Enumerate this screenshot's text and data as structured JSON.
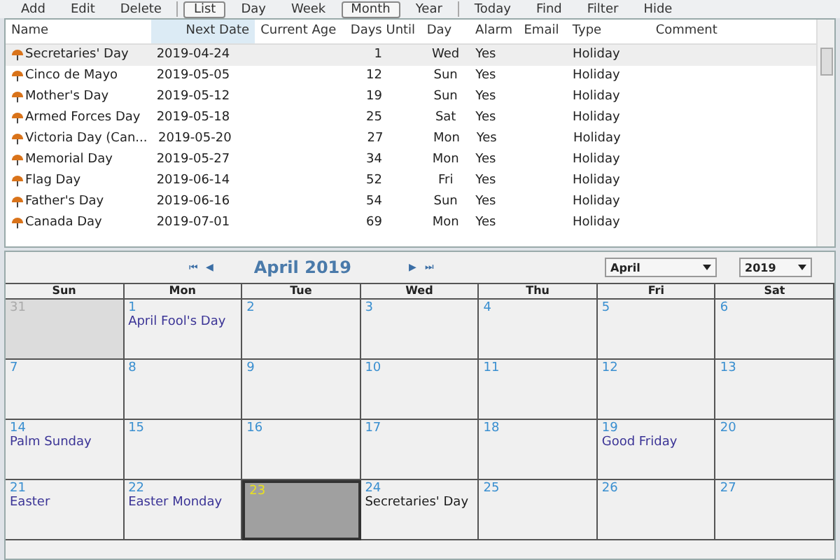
{
  "toolbar": [
    {
      "label": "Add",
      "selected": false
    },
    {
      "label": "Edit",
      "selected": false
    },
    {
      "label": "Delete",
      "selected": false,
      "divider_after": true
    },
    {
      "label": "List",
      "selected": true
    },
    {
      "label": "Day",
      "selected": false
    },
    {
      "label": "Week",
      "selected": false
    },
    {
      "label": "Month",
      "selected": true
    },
    {
      "label": "Year",
      "selected": false,
      "divider_after": true
    },
    {
      "label": "Today",
      "selected": false
    },
    {
      "label": "Find",
      "selected": false
    },
    {
      "label": "Filter",
      "selected": false
    },
    {
      "label": "Hide",
      "selected": false
    }
  ],
  "table": {
    "columns": [
      {
        "label": "Name",
        "sorted": false
      },
      {
        "label": "Next Date",
        "sorted": true
      },
      {
        "label": "Current Age",
        "sorted": false
      },
      {
        "label": "Days Until",
        "sorted": false
      },
      {
        "label": "Day",
        "sorted": false
      },
      {
        "label": "Alarm",
        "sorted": false
      },
      {
        "label": "Email",
        "sorted": false
      },
      {
        "label": "Type",
        "sorted": false
      },
      {
        "label": "Comment",
        "sorted": false
      }
    ],
    "rows": [
      {
        "selected": true,
        "cells": [
          "Secretaries' Day",
          "2019-04-24",
          "",
          "1",
          "Wed",
          "Yes",
          "",
          "Holiday",
          ""
        ]
      },
      {
        "selected": false,
        "cells": [
          "Cinco de Mayo",
          "2019-05-05",
          "",
          "12",
          "Sun",
          "Yes",
          "",
          "Holiday",
          ""
        ]
      },
      {
        "selected": false,
        "cells": [
          "Mother's Day",
          "2019-05-12",
          "",
          "19",
          "Sun",
          "Yes",
          "",
          "Holiday",
          ""
        ]
      },
      {
        "selected": false,
        "cells": [
          "Armed Forces Day",
          "2019-05-18",
          "",
          "25",
          "Sat",
          "Yes",
          "",
          "Holiday",
          ""
        ]
      },
      {
        "selected": false,
        "cells": [
          "Victoria Day (Can...",
          "2019-05-20",
          "",
          "27",
          "Mon",
          "Yes",
          "",
          "Holiday",
          ""
        ]
      },
      {
        "selected": false,
        "cells": [
          "Memorial Day",
          "2019-05-27",
          "",
          "34",
          "Mon",
          "Yes",
          "",
          "Holiday",
          ""
        ]
      },
      {
        "selected": false,
        "cells": [
          "Flag Day",
          "2019-06-14",
          "",
          "52",
          "Fri",
          "Yes",
          "",
          "Holiday",
          ""
        ]
      },
      {
        "selected": false,
        "cells": [
          "Father's Day",
          "2019-06-16",
          "",
          "54",
          "Sun",
          "Yes",
          "",
          "Holiday",
          ""
        ]
      },
      {
        "selected": false,
        "cells": [
          "Canada Day",
          "2019-07-01",
          "",
          "69",
          "Mon",
          "Yes",
          "",
          "Holiday",
          ""
        ]
      }
    ]
  },
  "calendar": {
    "nav": {
      "first": "⏮",
      "prev": "◀",
      "title": "April 2019",
      "next": "▶",
      "last": "⏭"
    },
    "month_select": "April",
    "year_select": "2019",
    "weekdays": [
      "Sun",
      "Mon",
      "Tue",
      "Wed",
      "Thu",
      "Fri",
      "Sat"
    ],
    "weeks": [
      [
        {
          "day": "31",
          "other_month": true,
          "today": false
        },
        {
          "day": "1",
          "other_month": false,
          "today": false,
          "events": [
            {
              "title": "April Fool's Day",
              "color": "#3b3496"
            }
          ]
        },
        {
          "day": "2",
          "other_month": false,
          "today": false
        },
        {
          "day": "3",
          "other_month": false,
          "today": false
        },
        {
          "day": "4",
          "other_month": false,
          "today": false
        },
        {
          "day": "5",
          "other_month": false,
          "today": false
        },
        {
          "day": "6",
          "other_month": false,
          "today": false
        }
      ],
      [
        {
          "day": "7",
          "other_month": false,
          "today": false
        },
        {
          "day": "8",
          "other_month": false,
          "today": false
        },
        {
          "day": "9",
          "other_month": false,
          "today": false
        },
        {
          "day": "10",
          "other_month": false,
          "today": false
        },
        {
          "day": "11",
          "other_month": false,
          "today": false
        },
        {
          "day": "12",
          "other_month": false,
          "today": false
        },
        {
          "day": "13",
          "other_month": false,
          "today": false
        }
      ],
      [
        {
          "day": "14",
          "other_month": false,
          "today": false,
          "events": [
            {
              "title": "Palm Sunday",
              "color": "#3b3496"
            }
          ]
        },
        {
          "day": "15",
          "other_month": false,
          "today": false
        },
        {
          "day": "16",
          "other_month": false,
          "today": false
        },
        {
          "day": "17",
          "other_month": false,
          "today": false
        },
        {
          "day": "18",
          "other_month": false,
          "today": false
        },
        {
          "day": "19",
          "other_month": false,
          "today": false,
          "events": [
            {
              "title": "Good Friday",
              "color": "#3b3496"
            }
          ]
        },
        {
          "day": "20",
          "other_month": false,
          "today": false
        }
      ],
      [
        {
          "day": "21",
          "other_month": false,
          "today": false,
          "events": [
            {
              "title": "Easter",
              "color": "#3b3496"
            }
          ]
        },
        {
          "day": "22",
          "other_month": false,
          "today": false,
          "events": [
            {
              "title": "Easter Monday",
              "color": "#3b3496"
            }
          ]
        },
        {
          "day": "23",
          "other_month": false,
          "today": true
        },
        {
          "day": "24",
          "other_month": false,
          "today": false,
          "events": [
            {
              "title": "Secretaries' Day",
              "color": "#1a1a1a"
            }
          ]
        },
        {
          "day": "25",
          "other_month": false,
          "today": false
        },
        {
          "day": "26",
          "other_month": false,
          "today": false
        },
        {
          "day": "27",
          "other_month": false,
          "today": false
        }
      ]
    ]
  }
}
